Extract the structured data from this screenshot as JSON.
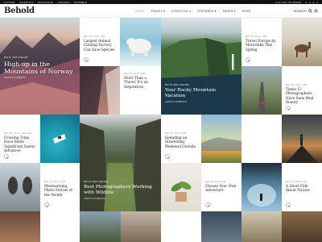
{
  "topbar": {
    "items": [
      "TWITTER",
      "FACEBOOK",
      "INSTAGRAM",
      "LINKEDIN",
      "DRIBBBLE"
    ],
    "right": "FOLLOW ON WIRED"
  },
  "header": {
    "logo": "Behold",
    "nav": [
      "HOME",
      "TRAVEL",
      "LIFESTYLE",
      "FEATURES",
      "PAGES",
      "SHOP"
    ],
    "search_label": "SEARCH"
  },
  "posts": {
    "p1": {
      "meta": "MAY 01, 2016 / ICELAND",
      "title": "High up in the Mountains of Norway",
      "author": "CAROLYN ROBINSON"
    },
    "p2": {
      "meta": "MAY 01, 2016 / ART",
      "title": "Largest Animal Cloning Factory Can Save Species"
    },
    "p3": {
      "meta": "MAY 01, 2016 / ICELAND",
      "title": "Your Rocky Mountain Vacation",
      "author": "CAROLYN ROBINSON"
    },
    "p4": {
      "meta": "MAY 01, 2016 / ART",
      "title": "Travel Europe by Motorbike This Spring"
    },
    "p5": {
      "meta": "MAY 01, 2016 / ART",
      "title": "More Than a Travel, It's an Inspiration"
    },
    "p6": {
      "meta": "MAY 01, 2016 / ART",
      "title": "These 12 Photographers Have Seen Real Beauty"
    },
    "p7": {
      "meta": "MAY 01, 2016 / ICELAND",
      "title": "Cruising Trips Have Made Significant Safety Advances"
    },
    "p8": {
      "meta": "MAY 01, 2016 / ICELAND",
      "title": "Best Photographers Working with Wildlife",
      "author": "CAROLYN ROBINSON"
    },
    "p9": {
      "meta": "MAY 01, 2016 / ART",
      "title": "Spending an Interesting Weekend Outside"
    },
    "p10": {
      "meta": "MAY 01, 2016 / ART",
      "title": "Mesmerizing Photo Stories of the Month"
    },
    "p11": {
      "meta": "MAY 01, 2016 / ART",
      "title": "Choose Your Own Adventure"
    },
    "p12": {
      "meta": "MAY 01, 2016 / ART",
      "title": "A Short Film About Nature"
    }
  },
  "colors": {
    "accent": "#e0785a",
    "topbar": "#111111"
  }
}
